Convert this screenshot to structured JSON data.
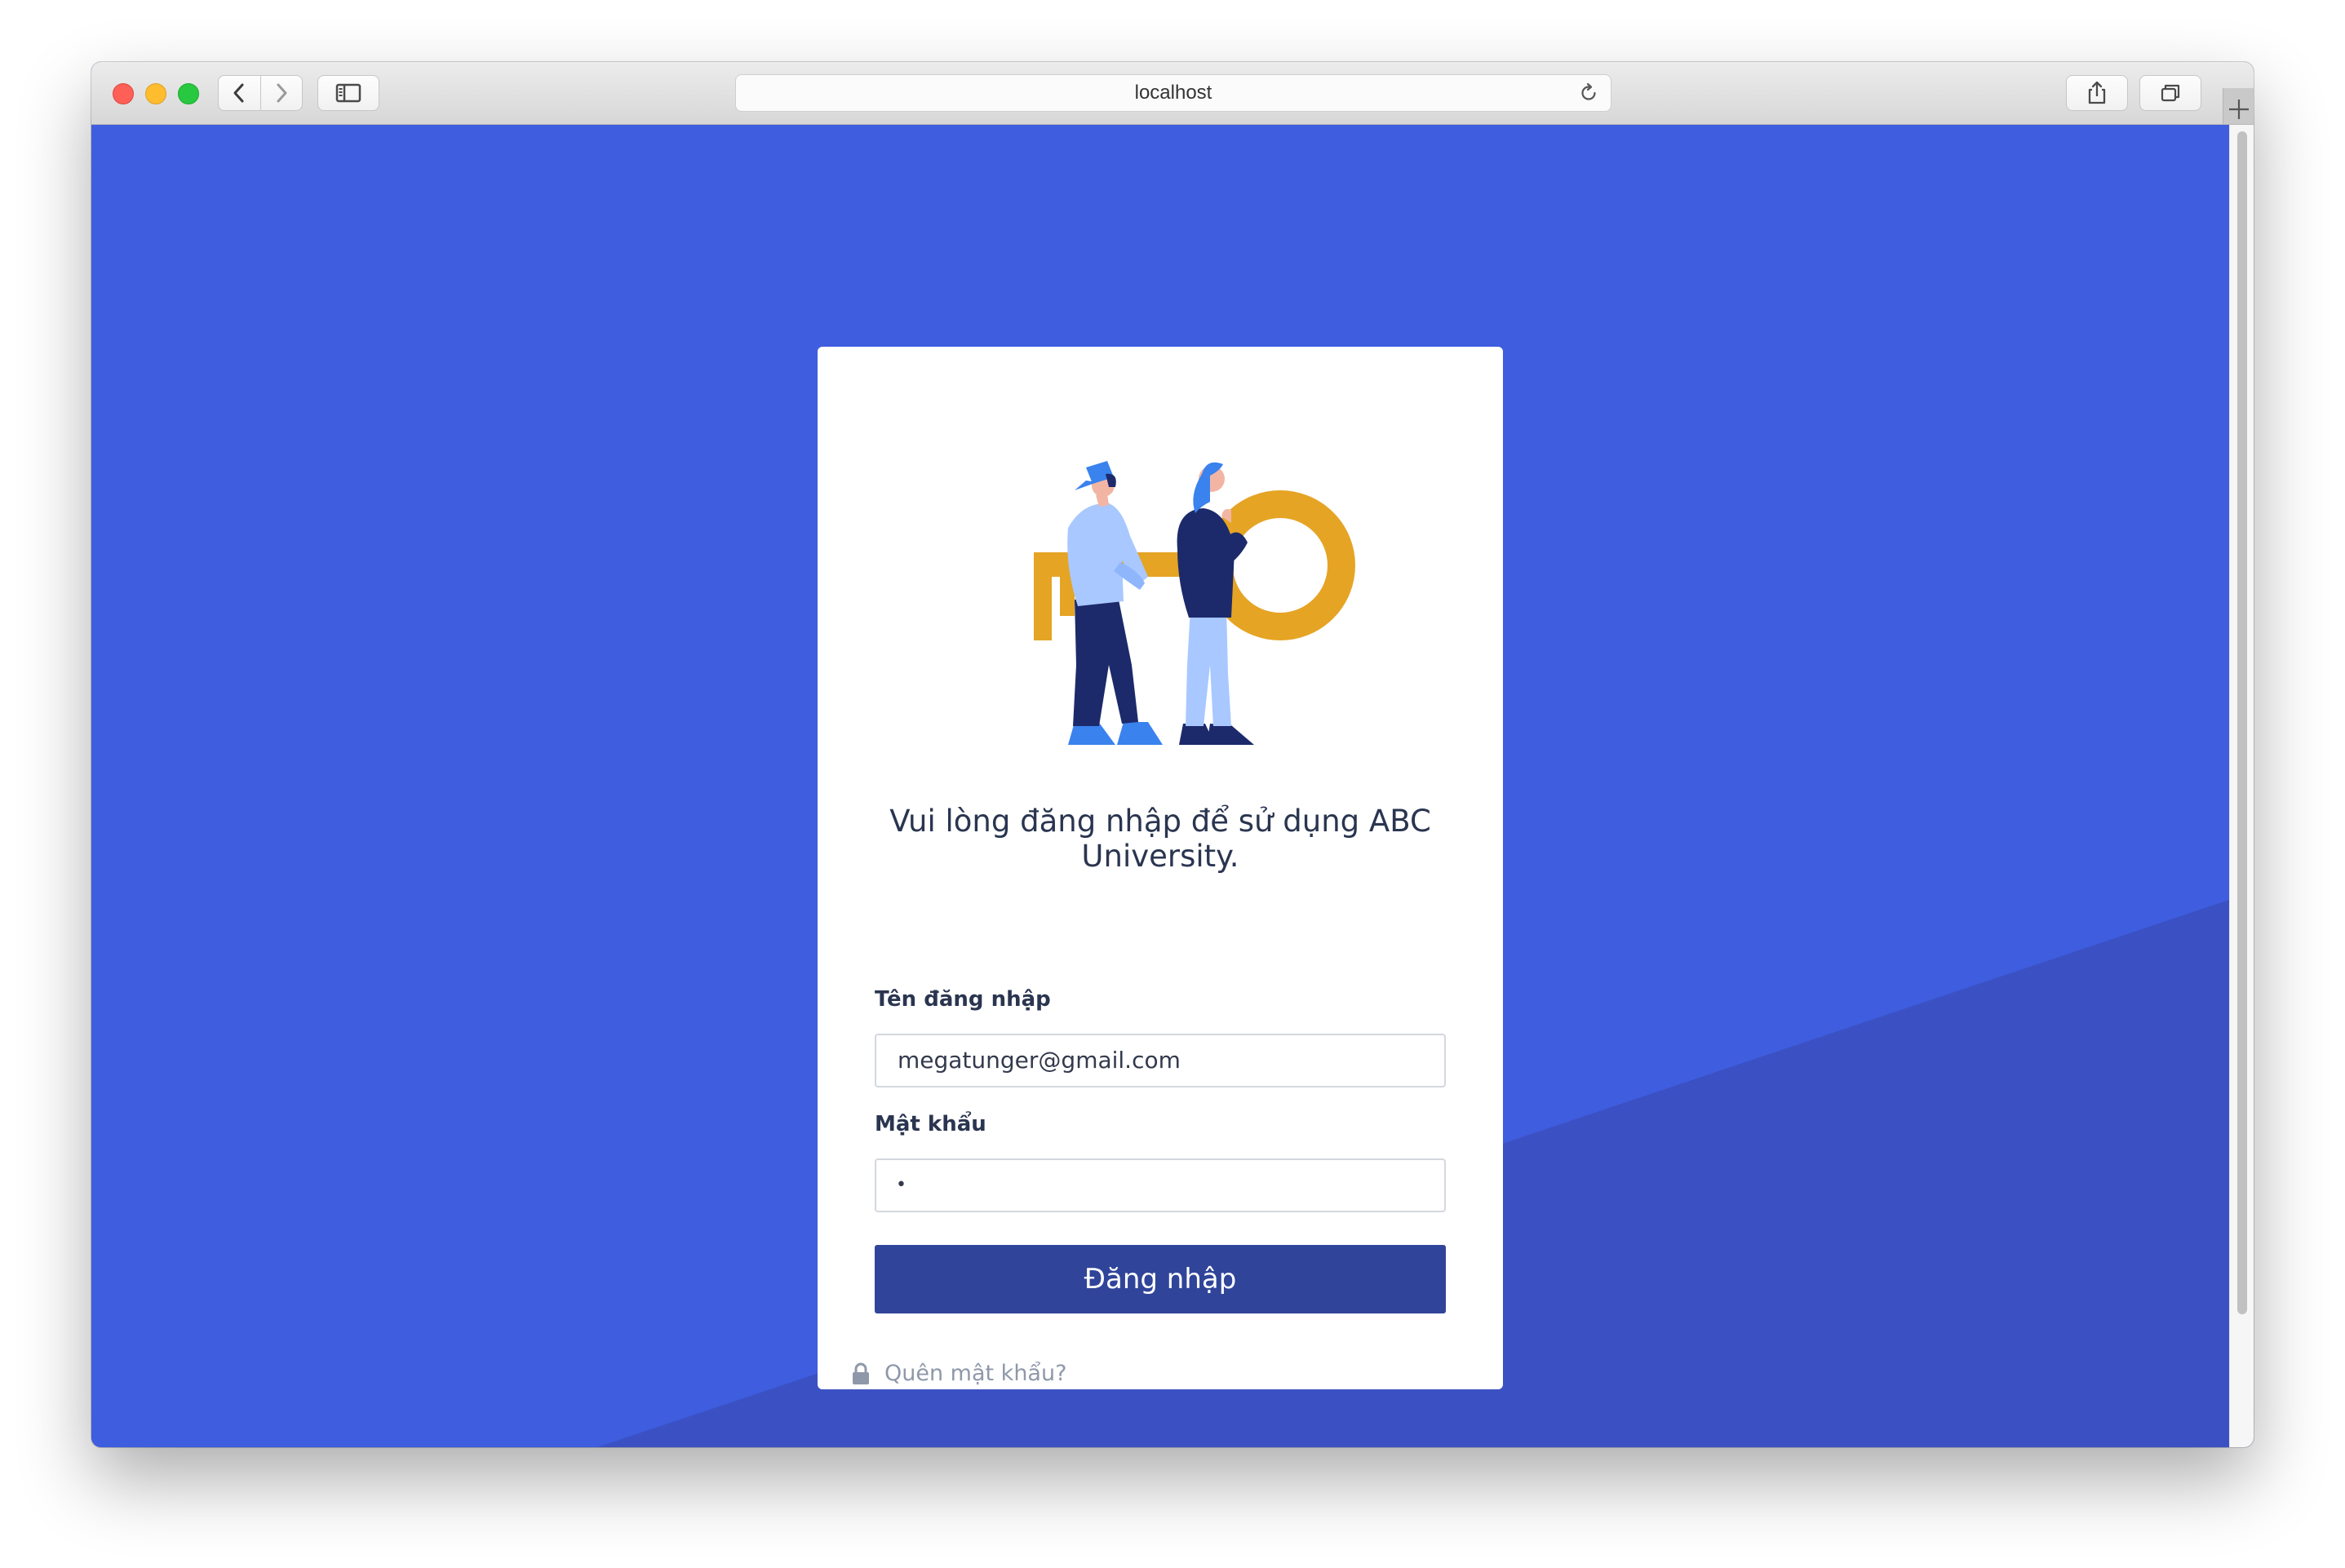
{
  "browser": {
    "url": "localhost"
  },
  "login": {
    "title": "Vui lòng đăng nhập để sử dụng ABC University.",
    "username_label": "Tên đăng nhập",
    "username_value": "megatunger@gmail.com",
    "password_label": "Mật khẩu",
    "password_value": "•",
    "submit_label": "Đăng nhập",
    "forgot_label": "Quên mật khẩu?"
  },
  "colors": {
    "background": "#3f5ddf",
    "background_shape": "#3b51c3",
    "button": "#304599",
    "key": "#e5a424"
  }
}
